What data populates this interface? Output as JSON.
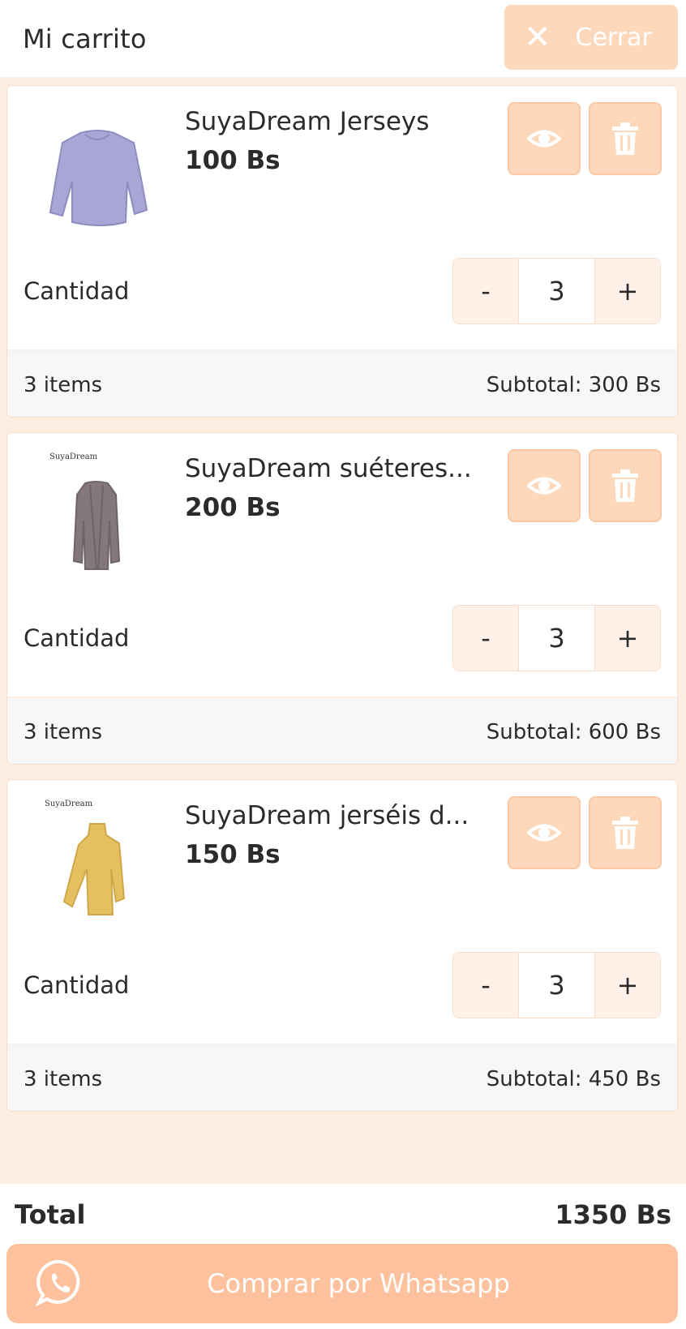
{
  "header": {
    "title": "Mi carrito",
    "close_label": "Cerrar"
  },
  "cart": {
    "items": [
      {
        "name": "SuyaDream Jerseys",
        "price": "100 Bs",
        "quantity_label": "Cantidad",
        "quantity": "3",
        "minus": "-",
        "plus": "+",
        "items_count": "3 items",
        "subtotal": "Subtotal: 300 Bs",
        "image_color": "#a8a6d4",
        "brand_mark": ""
      },
      {
        "name": "SuyaDream suéteres...",
        "price": "200 Bs",
        "quantity_label": "Cantidad",
        "quantity": "3",
        "minus": "-",
        "plus": "+",
        "items_count": "3 items",
        "subtotal": "Subtotal: 600 Bs",
        "image_color": "#85787a",
        "brand_mark": "SuyaDream"
      },
      {
        "name": "SuyaDream jerséis d...",
        "price": "150 Bs",
        "quantity_label": "Cantidad",
        "quantity": "3",
        "minus": "-",
        "plus": "+",
        "items_count": "3 items",
        "subtotal": "Subtotal: 450 Bs",
        "image_color": "#e6c060",
        "brand_mark": "SuyaDream"
      }
    ]
  },
  "summary": {
    "total_label": "Total",
    "total_value": "1350 Bs"
  },
  "checkout": {
    "label": "Comprar por Whatsapp"
  },
  "colors": {
    "accent": "#fdd8bb",
    "button": "#fdc29d",
    "background": "#fdeee4"
  },
  "icons": {
    "close": "close-icon",
    "view": "eye-icon",
    "delete": "trash-icon",
    "whatsapp": "whatsapp-icon"
  }
}
